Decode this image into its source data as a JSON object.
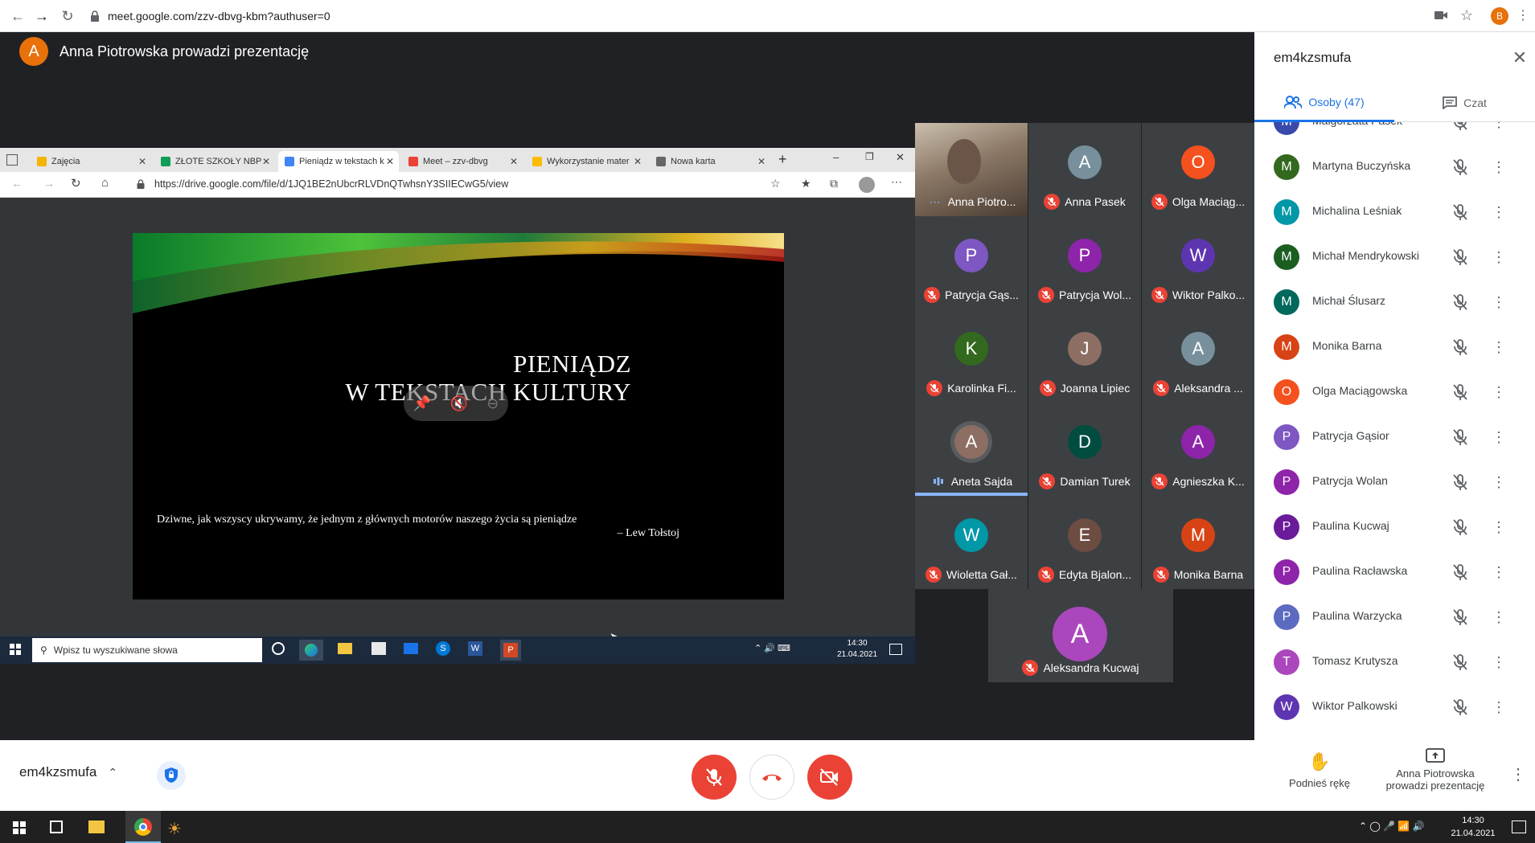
{
  "browser": {
    "url": "meet.google.com/zzv-dbvg-kbm?authuser=0",
    "profile_initial": "B"
  },
  "presenter_banner": {
    "initial": "A",
    "text": "Anna Piotrowska prowadzi prezentację"
  },
  "shared_screen": {
    "tabs": [
      {
        "label": "Zajęcia",
        "color": "#f4b400"
      },
      {
        "label": "ZŁOTE SZKOŁY NBP",
        "color": "#0f9d58"
      },
      {
        "label": "Pieniądz w tekstach k",
        "color": "#4285f4"
      },
      {
        "label": "Meet – zzv-dbvg",
        "color": "#ea4335"
      },
      {
        "label": "Wykorzystanie mater",
        "color": "#fbbc05"
      },
      {
        "label": "Nowa karta",
        "color": "#666666"
      }
    ],
    "url": "https://drive.google.com/file/d/1JQ1BE2nUbcrRLVDnQTwhsnY3SIIECwG5/view",
    "slide": {
      "title_line1": "PIENIĄDZ",
      "title_line2": "W TEKSTACH KULTURY",
      "quote": "Dziwne, jak wszyscy ukrywamy, że jednym z głównych motorów naszego życia są pieniądze",
      "author": "– Lew Tołstoj"
    },
    "taskbar": {
      "search_placeholder": "Wpisz tu wyszukiwane słowa",
      "time": "14:30",
      "date": "21.04.2021"
    }
  },
  "participants": [
    {
      "name": "Anna Piotro...",
      "initial": "A",
      "color": "#6d4c41",
      "video": true
    },
    {
      "name": "Anna Pasek",
      "initial": "A",
      "color": "#78909c"
    },
    {
      "name": "Olga Maciąg...",
      "initial": "O",
      "color": "#f4511e"
    },
    {
      "name": "Patrycja Gąs...",
      "initial": "P",
      "color": "#7e57c2"
    },
    {
      "name": "Patrycja Wol...",
      "initial": "P",
      "color": "#8e24aa"
    },
    {
      "name": "Wiktor Palko...",
      "initial": "W",
      "color": "#5e35b1"
    },
    {
      "name": "Karolinka Fi...",
      "initial": "K",
      "color": "#33691e"
    },
    {
      "name": "Joanna Lipiec",
      "initial": "J",
      "color": "#8d6e63"
    },
    {
      "name": "Aleksandra ...",
      "initial": "A",
      "color": "#78909c"
    },
    {
      "name": "Aneta Sajda",
      "initial": "A",
      "color": "#8d6e63",
      "speaking": true
    },
    {
      "name": "Damian Turek",
      "initial": "D",
      "color": "#004d40"
    },
    {
      "name": "Agnieszka K...",
      "initial": "A",
      "color": "#8e24aa"
    },
    {
      "name": "Wioletta Gał...",
      "initial": "W",
      "color": "#0097a7"
    },
    {
      "name": "Edyta Bjalon...",
      "initial": "E",
      "color": "#6d4c41"
    },
    {
      "name": "Monika Barna",
      "initial": "M",
      "color": "#d84315"
    },
    {
      "name": "Aleksandra Kucwaj",
      "initial": "A",
      "color": "#ab47bc"
    }
  ],
  "panel": {
    "title": "em4kzsmufa",
    "tab_people": "Osoby (47)",
    "tab_chat": "Czat",
    "people": [
      {
        "name": "Małgorzata Pasek",
        "initial": "M",
        "color": "#3949ab"
      },
      {
        "name": "Martyna Buczyńska",
        "initial": "M",
        "color": "#33691e"
      },
      {
        "name": "Michalina Leśniak",
        "initial": "M",
        "color": "#0097a7"
      },
      {
        "name": "Michał Mendrykowski",
        "initial": "M",
        "color": "#1b5e20"
      },
      {
        "name": "Michał Ślusarz",
        "initial": "M",
        "color": "#00695c"
      },
      {
        "name": "Monika Barna",
        "initial": "M",
        "color": "#d84315"
      },
      {
        "name": "Olga Maciągowska",
        "initial": "O",
        "color": "#f4511e"
      },
      {
        "name": "Patrycja Gąsior",
        "initial": "P",
        "color": "#7e57c2"
      },
      {
        "name": "Patrycja Wolan",
        "initial": "P",
        "color": "#8e24aa"
      },
      {
        "name": "Paulina Kucwaj",
        "initial": "P",
        "color": "#6a1b9a"
      },
      {
        "name": "Paulina Racławska",
        "initial": "P",
        "color": "#8e24aa"
      },
      {
        "name": "Paulina Warzycka",
        "initial": "P",
        "color": "#5c6bc0"
      },
      {
        "name": "Tomasz Krutysza",
        "initial": "T",
        "color": "#ab47bc"
      },
      {
        "name": "Wiktor Palkowski",
        "initial": "W",
        "color": "#5e35b1"
      }
    ]
  },
  "bottom_bar": {
    "meeting_code": "em4kzsmufa",
    "raise_hand": "Podnieś rękę",
    "present_line1": "Anna Piotrowska",
    "present_line2": "prowadzi prezentację"
  },
  "os_taskbar": {
    "time": "14:30",
    "date": "21.04.2021"
  }
}
